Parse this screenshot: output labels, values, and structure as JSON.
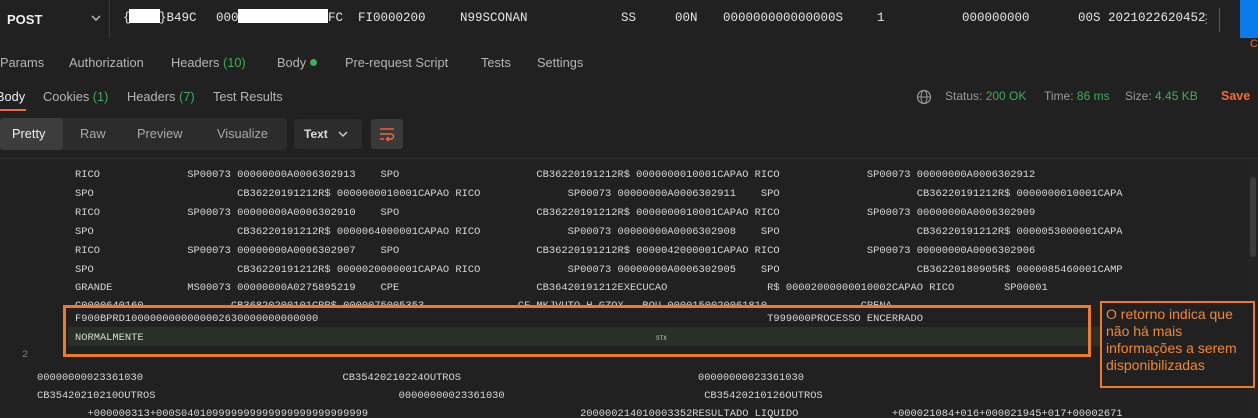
{
  "request": {
    "method": "POST",
    "url_segments": [
      "{",
      "}B49C",
      "000",
      "FC",
      "FI0000200",
      "N99SCONAN",
      "SS",
      "00N",
      "000000000000000S",
      "1",
      "000000000",
      "00S 2021022620452"
    ],
    "url_overflow": "⋮"
  },
  "request_tabs": {
    "params": "Params",
    "authorization": "Authorization",
    "headers_label": "Headers",
    "headers_count": "(10)",
    "body": "Body",
    "prerequest": "Pre-request Script",
    "tests": "Tests",
    "settings": "Settings",
    "right_edge_char": "C"
  },
  "response_tabs": {
    "body": "Body",
    "cookies_label": "Cookies",
    "cookies_count": "(1)",
    "headers_label": "Headers",
    "headers_count": "(7)",
    "test_results": "Test Results"
  },
  "response_meta": {
    "status_label": "Status:",
    "status_value": "200 OK",
    "time_label": "Time:",
    "time_value": "86 ms",
    "size_label": "Size:",
    "size_value": "4.45 KB",
    "save": "Save"
  },
  "view": {
    "pretty": "Pretty",
    "raw": "Raw",
    "preview": "Preview",
    "visualize": "Visualize",
    "format": "Text"
  },
  "code": {
    "lines": [
      "RICO              SP00073 00000000A0006302913    SPO                      CB36220191212R$ 0000000010001CAPAO RICO              SP00073 00000000A0006302912",
      "SPO                       CB36220191212R$ 0000000010001CAPAO RICO              SP00073 00000000A0006302911    SPO                      CB36220191212R$ 0000000010001CAPA",
      "RICO              SP00073 00000000A0006302910    SPO                      CB36220191212R$ 0000000010001CAPAO RICO              SP00073 00000000A0006302909",
      "SPO                       CB36220191212R$ 0000064000001CAPAO RICO              SP00073 00000000A0006302908    SPO                      CB36220191212R$ 0000053000001CAPA",
      "RICO              SP00073 00000000A0006302907    SPO                      CB36220191212R$ 0000042000001CAPAO RICO              SP00073 00000000A0006302906",
      "SPO                       CB36220191212R$ 0000020000001CAPAO RICO              SP00073 00000000A0006302905    SPO                      CB36220180905R$ 0000085460001CAMP",
      "GRANDE            MS00073 00000000A0275895219    CPE                      CB36420191212EXECUCAO                R$ 00002000000010002CAPAO RICO        SP00001",
      "C0000640160              CB36820200101CRR$ 0000075005353               CF MKJVUTO H GZOX   BOU 0000150020061810               CRENA",
      "F900BPRD1000000000000002630000000000000                                                                        T999000PROCESSO ENCERRADO",
      "NORMALMENTE",
      "",
      "00000000023361030                                CB35420210224OUTROS                                      00000000023361030",
      "CB35420210210OUTROS                                       00000000023361030                                CB35420210126OUTROS",
      "  +000000313+000S040109999999999999999999999999                                  200000214010003352RESULTADO LIQUIDO               +000021084+016+000021945+017+00002671"
    ],
    "line_number": "2",
    "stx": "STX"
  },
  "annotation": {
    "note": "O retorno indica que não há mais informações a serem disponibilizadas"
  },
  "colors": {
    "accent": "#f26b3a",
    "success": "#3fae5a",
    "annotation": "#f07a2a",
    "send": "#097bed"
  }
}
